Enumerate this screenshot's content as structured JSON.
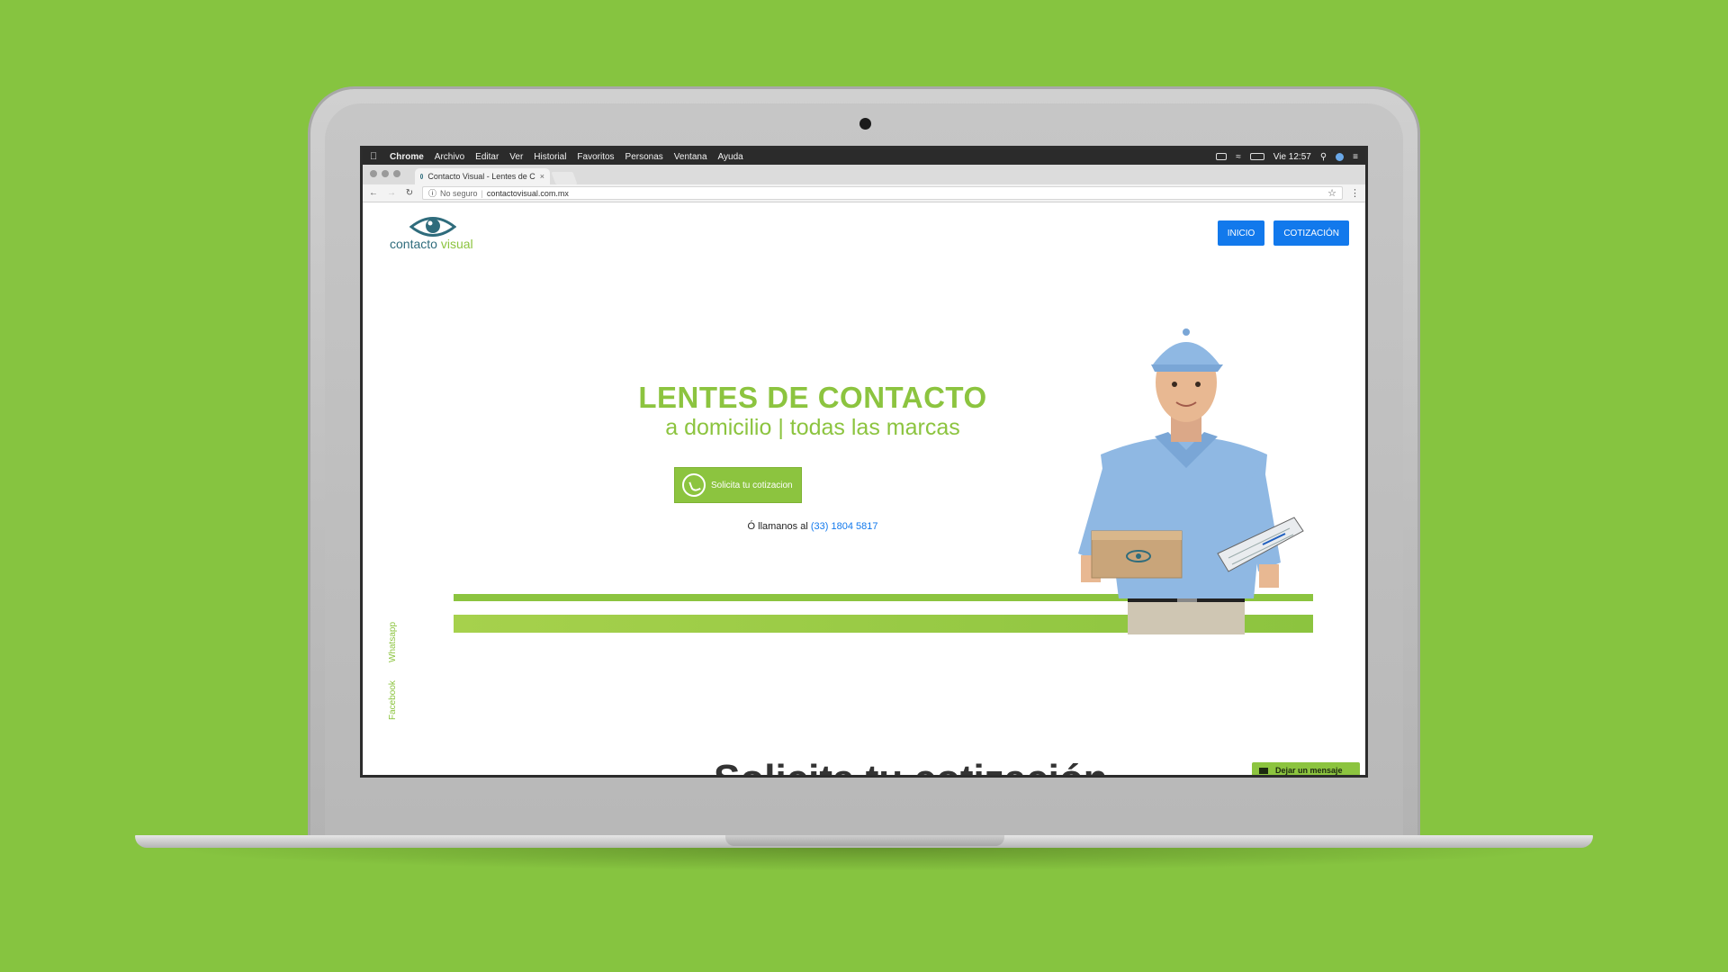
{
  "menubar": {
    "app": "Chrome",
    "items": [
      "Archivo",
      "Editar",
      "Ver",
      "Historial",
      "Favoritos",
      "Personas",
      "Ventana",
      "Ayuda"
    ],
    "clock": "Vie 12:57"
  },
  "browser": {
    "tab_title": "Contacto Visual - Lentes de C",
    "security": "No seguro",
    "url": "contactovisual.com.mx"
  },
  "site": {
    "logo": {
      "word1": "contacto",
      "word2": "visual"
    },
    "nav": [
      "INICIO",
      "COTIZACIÓN"
    ],
    "hero_title": "LENTES DE CONTACTO",
    "hero_subtitle": "a domicilio | todas las marcas",
    "cta_label": "Solicita tu cotizacion",
    "call_prefix": "Ó llamanos al",
    "phone": "(33) 1804 5817",
    "side_links": [
      "Whatsapp",
      "Facebook"
    ],
    "message_widget": "Dejar un mensaje",
    "section_heading_partial": "Solicita tu cotización"
  },
  "colors": {
    "background": "#86c440",
    "brand_green": "#8cc43f",
    "brand_teal": "#2f6c7c",
    "nav_blue": "#1279ec"
  }
}
